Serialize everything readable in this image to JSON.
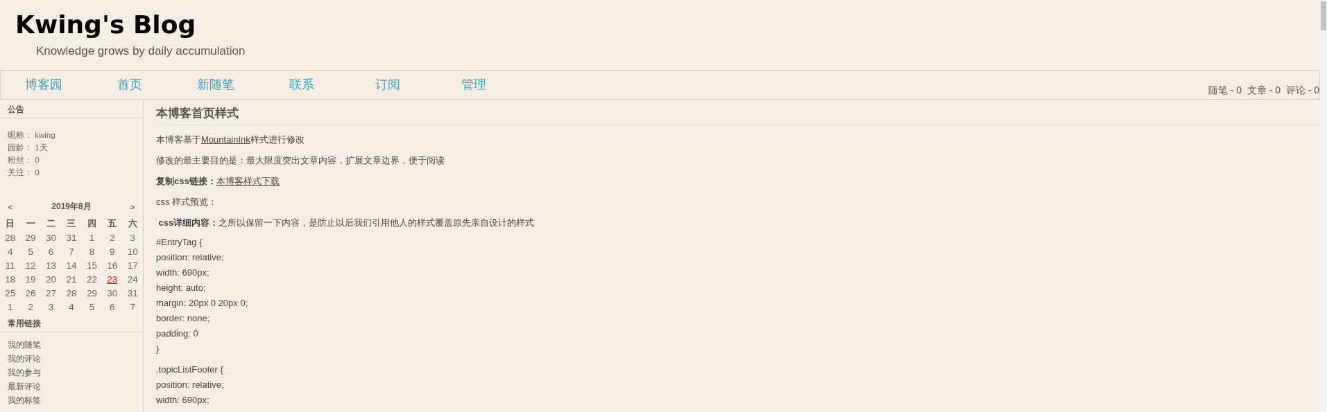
{
  "header": {
    "title": "Kwing's Blog",
    "subtitle": "Knowledge grows by daily accumulation"
  },
  "nav": {
    "items": [
      "博客园",
      "首页",
      "新随笔",
      "联系",
      "订阅",
      "管理"
    ],
    "stats": "随笔 - 0  文章 - 0  评论 - 0"
  },
  "sidebar": {
    "notice": {
      "title": "公告",
      "lines": [
        "昵称： kwing",
        "园龄： 1天",
        "粉丝： 0",
        "关注： 0"
      ]
    },
    "calendar": {
      "prev": "<",
      "month": "2019年8月",
      "next": ">",
      "weekdays": [
        "日",
        "一",
        "二",
        "三",
        "四",
        "五",
        "六"
      ],
      "weeks": [
        [
          {
            "day": "28",
            "today": false
          },
          {
            "day": "29",
            "today": false
          },
          {
            "day": "30",
            "today": false
          },
          {
            "day": "31",
            "today": false
          },
          {
            "day": "1",
            "today": false
          },
          {
            "day": "2",
            "today": false
          },
          {
            "day": "3",
            "today": false
          }
        ],
        [
          {
            "day": "4",
            "today": false
          },
          {
            "day": "5",
            "today": false
          },
          {
            "day": "6",
            "today": false
          },
          {
            "day": "7",
            "today": false
          },
          {
            "day": "8",
            "today": false
          },
          {
            "day": "9",
            "today": false
          },
          {
            "day": "10",
            "today": false
          }
        ],
        [
          {
            "day": "11",
            "today": false
          },
          {
            "day": "12",
            "today": false
          },
          {
            "day": "13",
            "today": false
          },
          {
            "day": "14",
            "today": false
          },
          {
            "day": "15",
            "today": false
          },
          {
            "day": "16",
            "today": false
          },
          {
            "day": "17",
            "today": false
          }
        ],
        [
          {
            "day": "18",
            "today": false
          },
          {
            "day": "19",
            "today": false
          },
          {
            "day": "20",
            "today": false
          },
          {
            "day": "21",
            "today": false
          },
          {
            "day": "22",
            "today": false
          },
          {
            "day": "23",
            "today": true
          },
          {
            "day": "24",
            "today": false
          }
        ],
        [
          {
            "day": "25",
            "today": false
          },
          {
            "day": "26",
            "today": false
          },
          {
            "day": "27",
            "today": false
          },
          {
            "day": "28",
            "today": false
          },
          {
            "day": "29",
            "today": false
          },
          {
            "day": "30",
            "today": false
          },
          {
            "day": "31",
            "today": false
          }
        ],
        [
          {
            "day": "1",
            "today": false
          },
          {
            "day": "2",
            "today": false
          },
          {
            "day": "3",
            "today": false
          },
          {
            "day": "4",
            "today": false
          },
          {
            "day": "5",
            "today": false
          },
          {
            "day": "6",
            "today": false
          },
          {
            "day": "7",
            "today": false
          }
        ]
      ]
    },
    "links": {
      "title": "常用链接",
      "items": [
        "我的随笔",
        "我的评论",
        "我的参与",
        "最新评论",
        "我的标签"
      ]
    }
  },
  "post": {
    "title": "本博客首页样式",
    "paragraphs": [
      [
        {
          "kind": "plain",
          "text": "本博客基于"
        },
        {
          "kind": "link",
          "text": "MountainInk"
        },
        {
          "kind": "plain",
          "text": "样式进行修改"
        }
      ],
      [
        {
          "kind": "plain",
          "text": "修改的最主要目的是：最大限度突出文章内容，扩展文章边界，便于阅读"
        }
      ],
      [
        {
          "kind": "bold",
          "text": "复制css链接："
        },
        {
          "kind": "link",
          "text": "本博客样式下载"
        }
      ],
      [
        {
          "kind": "plain",
          "text": "css 样式预览："
        }
      ],
      [
        {
          "kind": "bold",
          "text": " css详细内容："
        },
        {
          "kind": "plain",
          "text": "之所以保留一下内容，是防止以后我们引用他人的样式覆盖原先亲自设计的样式"
        }
      ]
    ],
    "code_blocks": [
      [
        "#EntryTag {",
        "position: relative;",
        "width: 690px;",
        "height: auto;",
        "margin: 20px 0 20px 0;",
        "border: none;",
        "padding: 0",
        "}"
      ],
      [
        ".topicListFooter {",
        "position: relative;",
        "width: 690px;"
      ]
    ]
  }
}
